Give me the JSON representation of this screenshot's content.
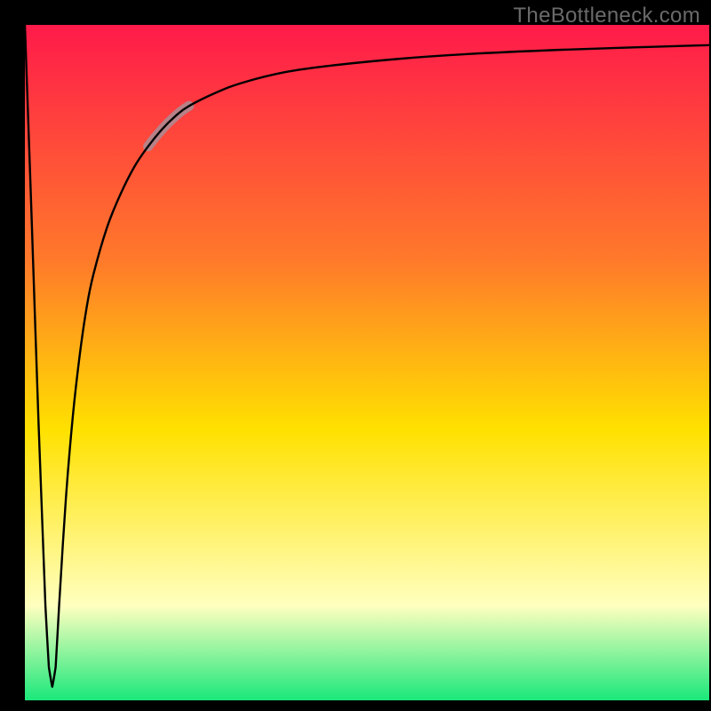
{
  "watermark": "TheBottleneck.com",
  "chart_data": {
    "type": "line",
    "title": "",
    "xlabel": "",
    "ylabel": "",
    "xlim": [
      0,
      100
    ],
    "ylim": [
      0,
      100
    ],
    "grid": false,
    "legend": false,
    "background_gradient": {
      "top": "#ff1a4a",
      "mid1": "#ff7a2a",
      "mid2": "#ffe100",
      "mid3": "#ffffbf",
      "bottom": "#1ae87a"
    },
    "series": [
      {
        "name": "bottleneck-curve",
        "x": [
          0.0,
          1.0,
          2.0,
          3.0,
          3.5,
          4.0,
          4.5,
          5.0,
          6.0,
          7.0,
          8.0,
          9.0,
          10.0,
          12.0,
          14.0,
          16.0,
          18.0,
          20.0,
          22.0,
          24.0,
          28.0,
          32.0,
          38.0,
          45.0,
          55.0,
          65.0,
          78.0,
          90.0,
          100.0
        ],
        "y": [
          100.0,
          71.0,
          41.0,
          14.0,
          5.0,
          2.0,
          5.0,
          14.0,
          30.0,
          42.0,
          51.0,
          58.0,
          63.0,
          70.0,
          75.0,
          79.0,
          82.0,
          84.5,
          86.5,
          88.0,
          90.0,
          91.5,
          93.0,
          94.0,
          95.0,
          95.7,
          96.3,
          96.7,
          97.0
        ]
      }
    ],
    "highlight_segment": {
      "series": "bottleneck-curve",
      "x_range": [
        18.0,
        24.0
      ],
      "color": "#b78188"
    }
  }
}
